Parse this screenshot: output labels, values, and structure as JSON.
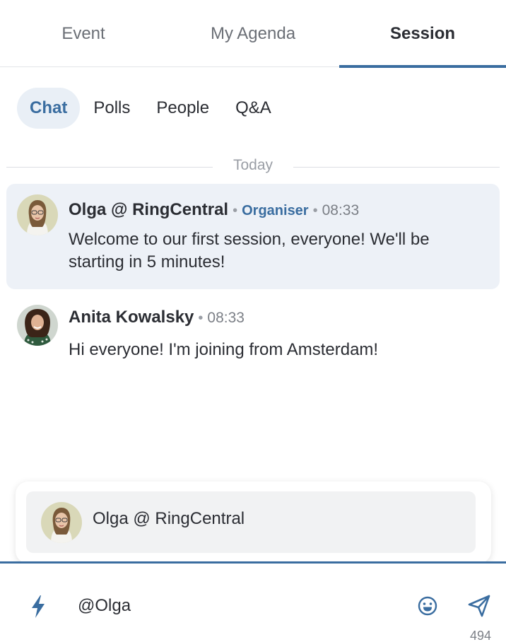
{
  "top_tabs": [
    {
      "label": "Event"
    },
    {
      "label": "My Agenda"
    },
    {
      "label": "Session"
    }
  ],
  "sub_tabs": [
    {
      "label": "Chat"
    },
    {
      "label": "Polls"
    },
    {
      "label": "People"
    },
    {
      "label": "Q&A"
    }
  ],
  "chat": {
    "divider_label": "Today",
    "messages": [
      {
        "author": "Olga @ RingCentral",
        "role": "Organiser",
        "time": "08:33",
        "text": "Welcome to our first session, everyone! We'll be starting in 5 minutes!"
      },
      {
        "author": "Anita Kowalsky",
        "time": "08:33",
        "text": "Hi everyone! I'm joining from Amsterdam!"
      }
    ]
  },
  "mention_popup": {
    "items": [
      {
        "name": "Olga @ RingCentral"
      }
    ]
  },
  "composer": {
    "value": "@Olga",
    "char_count": "494"
  },
  "colors": {
    "accent": "#3a6da0",
    "highlight_bg": "#edf1f7",
    "text": "#2b2d33",
    "muted": "#7b7f86"
  },
  "icons": [
    "lightning-icon",
    "emoji-icon",
    "send-icon"
  ]
}
